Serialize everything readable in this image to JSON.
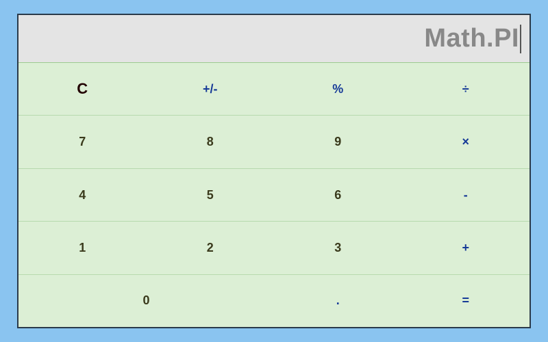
{
  "display": {
    "value": "Math.PI"
  },
  "keys": {
    "clear": "C",
    "sign": "+/-",
    "percent": "%",
    "divide": "÷",
    "seven": "7",
    "eight": "8",
    "nine": "9",
    "multiply": "×",
    "four": "4",
    "five": "5",
    "six": "6",
    "minus": "-",
    "one": "1",
    "two": "2",
    "three": "3",
    "plus": "+",
    "zero": "0",
    "decimal": ".",
    "equals": "="
  },
  "colors": {
    "background": "#8ac4f0",
    "keypad": "#dcefd5",
    "display_bg": "#e4e4e4",
    "display_text": "#888888",
    "operator": "#163a97",
    "number": "#3a3a1c"
  }
}
